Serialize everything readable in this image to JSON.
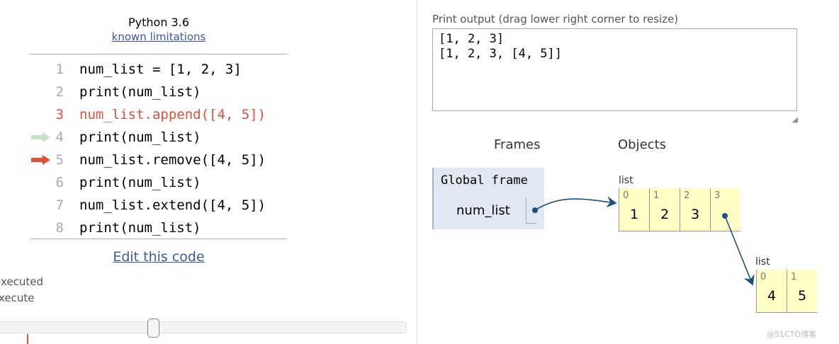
{
  "header": {
    "title": "Python 3.6",
    "limitations_link": "known limitations"
  },
  "code": {
    "lines": [
      {
        "num": "1",
        "text": "num_list = [1, 2, 3]"
      },
      {
        "num": "2",
        "text": "print(num_list)"
      },
      {
        "num": "3",
        "text": "num_list.append([4, 5])",
        "state": "error"
      },
      {
        "num": "4",
        "text": "print(num_list)",
        "marker": "just-executed"
      },
      {
        "num": "5",
        "text": "num_list.remove([4, 5])",
        "marker": "next-to-execute"
      },
      {
        "num": "6",
        "text": "print(num_list)"
      },
      {
        "num": "7",
        "text": "num_list.extend([4, 5])"
      },
      {
        "num": "8",
        "text": "print(num_list)"
      }
    ]
  },
  "edit_link": "Edit this code",
  "legend": {
    "executed": "executed",
    "execute": "xecute"
  },
  "colors": {
    "link": "#3d58a3",
    "error": "#e04f3a",
    "executed_arrow": "#c6e2c6",
    "next_arrow": "#e04f3a",
    "heap": "#ffffc6",
    "frame": "#e2e8f3",
    "pointer": "#1d4f80"
  },
  "output": {
    "label": "Print output (drag lower right corner to resize)",
    "text": "[1, 2, 3]\n[1, 2, 3, [4, 5]]"
  },
  "viz": {
    "frames_label": "Frames",
    "objects_label": "Objects",
    "global_frame": {
      "title": "Global frame",
      "var": "num_list"
    },
    "list1": {
      "type": "list",
      "cells": [
        {
          "i": "0",
          "v": "1"
        },
        {
          "i": "1",
          "v": "2"
        },
        {
          "i": "2",
          "v": "3"
        },
        {
          "i": "3",
          "v": ""
        }
      ]
    },
    "list2": {
      "type": "list",
      "cells": [
        {
          "i": "0",
          "v": "4"
        },
        {
          "i": "1",
          "v": "5"
        }
      ]
    }
  },
  "watermark": "@51CTO博客"
}
